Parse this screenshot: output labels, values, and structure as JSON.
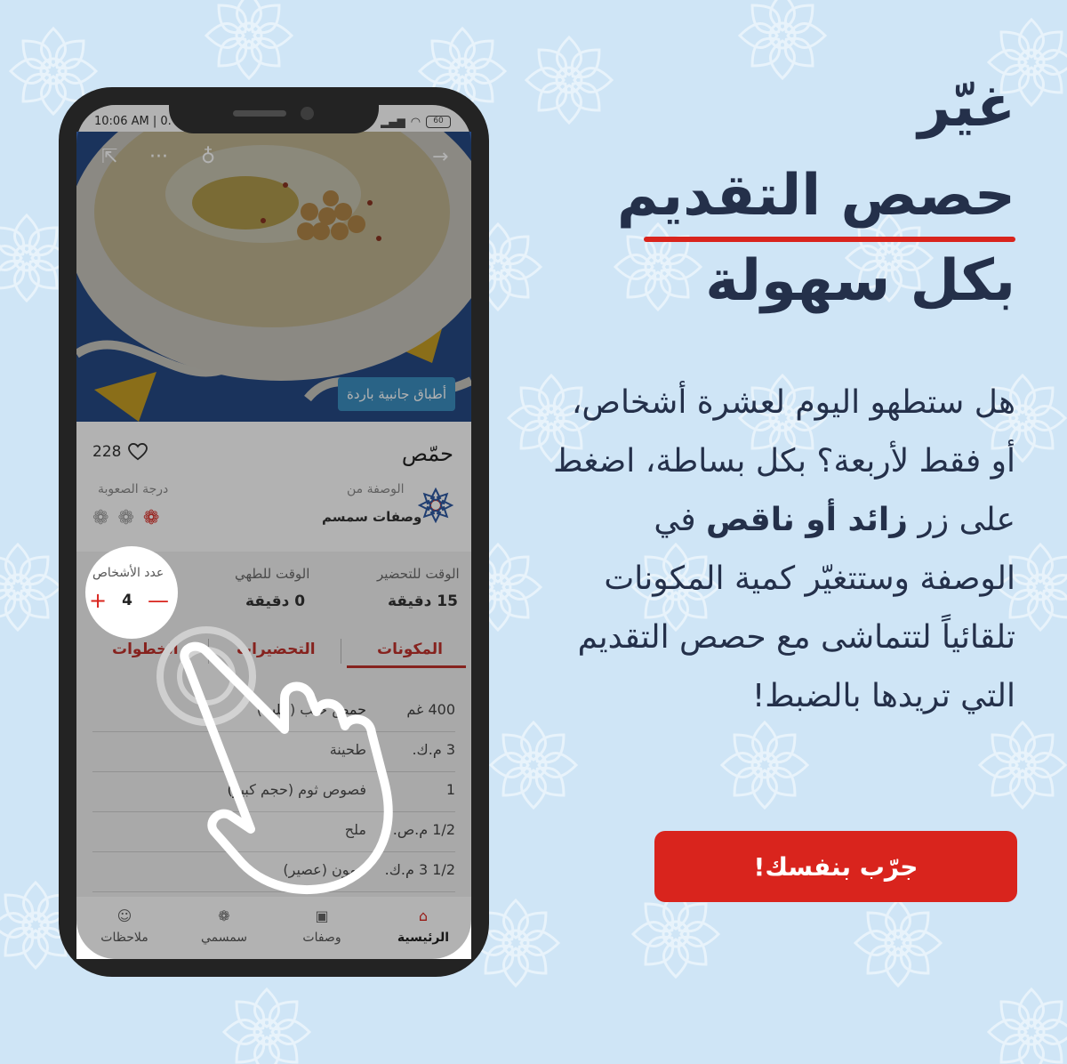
{
  "colors": {
    "background": "#cfe5f6",
    "pattern": "#ffffff",
    "heading": "#24304a",
    "accent_red": "#d9241d",
    "phone_body": "#232323",
    "tag_blue": "#3b8fc0"
  },
  "headline": {
    "line1": "غيّر",
    "line2": "حصص التقديم",
    "line3": "بكل سهولة"
  },
  "body": {
    "part1": "هل ستطهو اليوم لعشرة أشخاص، أو فقط لأربعة؟ بكل بساطة، اضغط على زر ",
    "bold1": "زائد أو ناقص",
    "part2": " في الوصفة وستتغيّر كمية المكونات تلقائياً لتتماشى مع حصص التقديم التي تريدها بالضبط!"
  },
  "cta": {
    "label": "جرّب بنفسك!"
  },
  "phone": {
    "status_time": "10:06 AM | 0.",
    "battery": "60",
    "hero_tag": "أطباق جانبية باردة",
    "hero_icons": {
      "share": "share-icon",
      "more": "more-icon",
      "tip": "lightbulb-icon",
      "back": "arrow-right-icon"
    },
    "recipe": {
      "title": "حمّص",
      "likes": "228",
      "source_label": "الوصفة من",
      "source_name": "وصفات سمسم",
      "difficulty_label": "درجة الصعوبة",
      "difficulty_level": 1,
      "difficulty_max": 3
    },
    "stats": {
      "prep_label": "الوقت للتحضير",
      "prep_value": "15 دقيقة",
      "cook_label": "الوقت للطهي",
      "cook_value": "0 دقيقة",
      "servings_label": "عدد الأشخاص",
      "servings_value": "4",
      "plus": "+",
      "minus": "—"
    },
    "tabs": [
      "المكونات",
      "التحضيرات",
      "الخطوات"
    ],
    "ingredients": [
      {
        "qty": "400 غم",
        "name": "حمص حلب (حلب)"
      },
      {
        "qty": "3 م.ك.",
        "name": "طحينة"
      },
      {
        "qty": "1",
        "name": "فصوص ثوم (حجم كبير)"
      },
      {
        "qty": "1/2 م.ص.",
        "name": "ملح"
      },
      {
        "qty": "1/2 3 م.ك.",
        "name": "ليمون (عصير)"
      }
    ],
    "nav": [
      {
        "label": "الرئيسية",
        "icon": "home-icon",
        "active": true
      },
      {
        "label": "وصفات",
        "icon": "recipes-icon",
        "active": false
      },
      {
        "label": "سمسمي",
        "icon": "flower-icon",
        "active": false
      },
      {
        "label": "ملاحظات",
        "icon": "smile-icon",
        "active": false
      }
    ]
  }
}
